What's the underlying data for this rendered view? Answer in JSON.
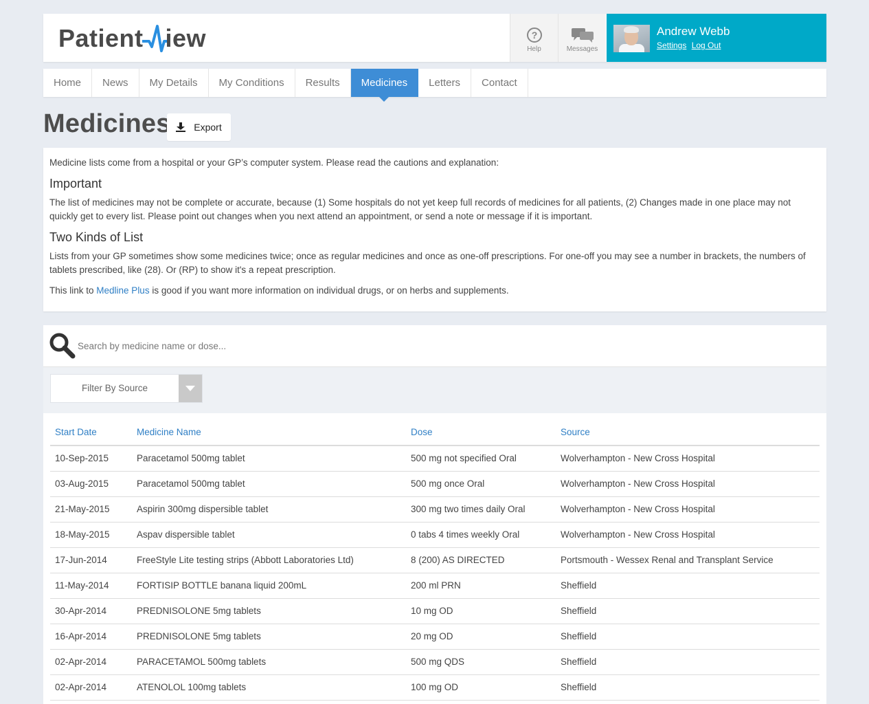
{
  "app": {
    "logo_left": "Patient",
    "logo_right": "iew"
  },
  "header": {
    "help_label": "Help",
    "messages_label": "Messages",
    "user_name": "Andrew Webb",
    "settings_link": "Settings",
    "logout_link": "Log Out"
  },
  "nav": {
    "items": [
      {
        "label": "Home",
        "active": false
      },
      {
        "label": "News",
        "active": false
      },
      {
        "label": "My Details",
        "active": false
      },
      {
        "label": "My Conditions",
        "active": false
      },
      {
        "label": "Results",
        "active": false
      },
      {
        "label": "Medicines",
        "active": true
      },
      {
        "label": "Letters",
        "active": false
      },
      {
        "label": "Contact",
        "active": false
      }
    ]
  },
  "page": {
    "title": "Medicines",
    "export_label": "Export"
  },
  "info": {
    "intro": "Medicine lists come from a hospital or your GP’s computer system. Please read the cautions and explanation:",
    "important_heading": "Important",
    "important_text": "The list of medicines may not be complete or accurate, because (1) Some hospitals do not yet keep full records of medicines for all patients, (2) Changes made in one place may not quickly get to every list. Please point out changes when you next attend an appointment, or send a note or message if it is important.",
    "kinds_heading": "Two Kinds of List",
    "kinds_text": "Lists from your GP sometimes show some medicines twice; once as regular medicines and once as one-off prescriptions. For one-off you may see a number in brackets, the numbers of tablets prescribed, like (28). Or (RP) to show it's a repeat prescription.",
    "link_prefix": "This link to ",
    "link_text": "Medline Plus",
    "link_suffix": " is good if you want more information on individual drugs, or on herbs and supplements."
  },
  "search": {
    "placeholder": "Search by medicine name or dose...",
    "value": ""
  },
  "filter": {
    "selected": "Filter By Source"
  },
  "table": {
    "headers": [
      "Start Date",
      "Medicine Name",
      "Dose",
      "Source"
    ],
    "rows": [
      [
        "10-Sep-2015",
        "Paracetamol 500mg tablet",
        "500 mg not specified Oral",
        "Wolverhampton - New Cross Hospital"
      ],
      [
        "03-Aug-2015",
        "Paracetamol 500mg tablet",
        "500 mg once Oral",
        "Wolverhampton - New Cross Hospital"
      ],
      [
        "21-May-2015",
        "Aspirin 300mg dispersible tablet",
        "300 mg two times daily Oral",
        "Wolverhampton - New Cross Hospital"
      ],
      [
        "18-May-2015",
        "Aspav dispersible tablet",
        "0 tabs 4 times weekly Oral",
        "Wolverhampton - New Cross Hospital"
      ],
      [
        "17-Jun-2014",
        "FreeStyle Lite testing strips (Abbott Laboratories Ltd)",
        "8 (200) AS DIRECTED",
        "Portsmouth - Wessex Renal and Transplant Service"
      ],
      [
        "11-May-2014",
        "FORTISIP BOTTLE banana liquid 200mL",
        "200 ml PRN",
        "Sheffield"
      ],
      [
        "30-Apr-2014",
        "PREDNISOLONE 5mg tablets",
        "10 mg OD",
        "Sheffield"
      ],
      [
        "16-Apr-2014",
        "PREDNISOLONE 5mg tablets",
        "20 mg OD",
        "Sheffield"
      ],
      [
        "02-Apr-2014",
        "PARACETAMOL 500mg tablets",
        "500 mg QDS",
        "Sheffield"
      ],
      [
        "02-Apr-2014",
        "ATENOLOL 100mg tablets",
        "100 mg OD",
        "Sheffield"
      ]
    ]
  },
  "colors": {
    "accent_blue": "#3e8dd6",
    "user_panel": "#00a9c8",
    "link": "#2f7fc5",
    "background": "#e8ecf2"
  }
}
